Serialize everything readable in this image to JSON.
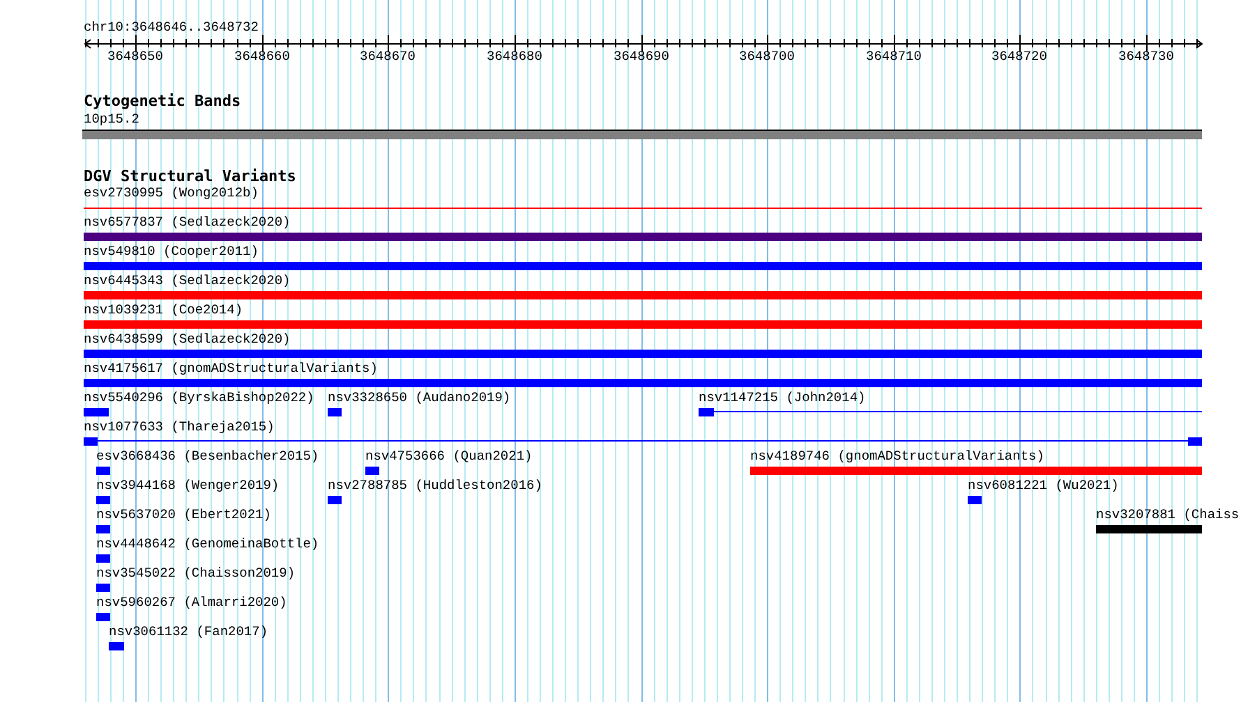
{
  "position": "chr10:3648646..3648732",
  "ruler": {
    "ticks": [
      "3648650",
      "3648660",
      "3648670",
      "3648680",
      "3648690",
      "3648700",
      "3648710",
      "3648720",
      "3648730"
    ]
  },
  "tracks": [
    {
      "title": "Cytogenetic Bands",
      "features": [
        {
          "label": "10p15.2",
          "color": "#808080",
          "kind": "band"
        }
      ]
    },
    {
      "title": "DGV Structural Variants",
      "features": [
        {
          "label": "esv2730995 (Wong2012b)",
          "color": "#ff0000",
          "kind": "line"
        },
        {
          "label": "nsv6577837 (Sedlazeck2020)",
          "color": "#4b0082",
          "kind": "bar"
        },
        {
          "label": "nsv549810 (Cooper2011)",
          "color": "#0000ff",
          "kind": "bar"
        },
        {
          "label": "nsv6445343 (Sedlazeck2020)",
          "color": "#ff0000",
          "kind": "bar"
        },
        {
          "label": "nsv1039231 (Coe2014)",
          "color": "#ff0000",
          "kind": "bar"
        },
        {
          "label": "nsv6438599 (Sedlazeck2020)",
          "color": "#0000ff",
          "kind": "bar"
        },
        {
          "label": "nsv4175617 (gnomADStructuralVariants)",
          "color": "#0000ff",
          "kind": "bar"
        },
        {
          "label": "nsv5540296 (ByrskaBishop2022)",
          "color": "#0000ff",
          "kind": "bar"
        },
        {
          "label": "nsv3328650 (Audano2019)",
          "color": "#0000ff",
          "kind": "bar"
        },
        {
          "label": "nsv1147215 (John2014)",
          "color": "#0000ff",
          "kind": "gapped"
        },
        {
          "label": "nsv1077633 (Thareja2015)",
          "color": "#0000ff",
          "kind": "gapped"
        },
        {
          "label": "esv3668436 (Besenbacher2015)",
          "color": "#0000ff",
          "kind": "bar"
        },
        {
          "label": "nsv4753666 (Quan2021)",
          "color": "#0000ff",
          "kind": "bar"
        },
        {
          "label": "nsv4189746 (gnomADStructuralVariants)",
          "color": "#ff0000",
          "kind": "bar"
        },
        {
          "label": "nsv3944168 (Wenger2019)",
          "color": "#0000ff",
          "kind": "bar"
        },
        {
          "label": "nsv2788785 (Huddleston2016)",
          "color": "#0000ff",
          "kind": "bar"
        },
        {
          "label": "nsv6081221 (Wu2021)",
          "color": "#0000ff",
          "kind": "bar"
        },
        {
          "label": "nsv5637020 (Ebert2021)",
          "color": "#0000ff",
          "kind": "bar"
        },
        {
          "label": "nsv3207881 (Chaiss",
          "color": "#000000",
          "kind": "bar"
        },
        {
          "label": "nsv4448642 (GenomeinaBottle)",
          "color": "#0000ff",
          "kind": "bar"
        },
        {
          "label": "nsv3545022 (Chaisson2019)",
          "color": "#0000ff",
          "kind": "bar"
        },
        {
          "label": "nsv5960267 (Almarri2020)",
          "color": "#0000ff",
          "kind": "bar"
        },
        {
          "label": "nsv3061132 (Fan2017)",
          "color": "#0000ff",
          "kind": "bar"
        }
      ]
    }
  ]
}
